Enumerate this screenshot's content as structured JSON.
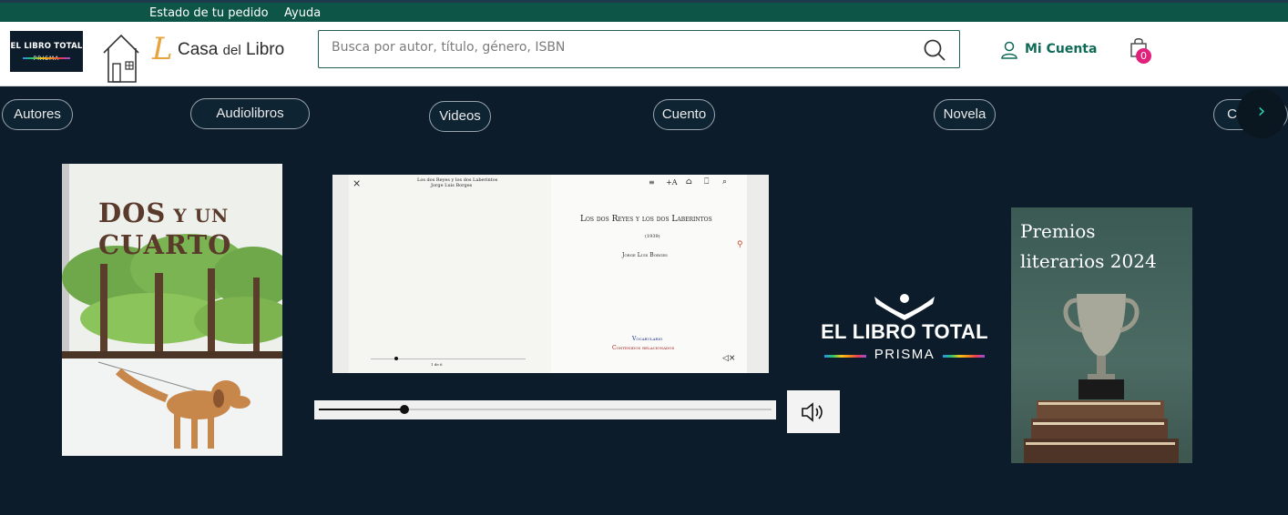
{
  "topbar": {
    "order_status": "Estado de tu pedido",
    "help": "Ayuda"
  },
  "header": {
    "badge_line1": "EL LIBRO TOTAL",
    "badge_line2": "PRISMA",
    "logo_mark": "L",
    "logo_text_1": "Casa ",
    "logo_text_2": "del",
    "logo_text_3": " Libro",
    "search_placeholder": "Busca por autor, título, género, ISBN",
    "account_label": "Mi Cuenta",
    "cart_count": "0"
  },
  "categories": [
    "Autores",
    "Audiolibros",
    "Videos",
    "Cuento",
    "Novela",
    "Crónica"
  ],
  "cover1": {
    "title_line1": "DOS",
    "title_small": " Y UN",
    "title_line2": "CUARTO"
  },
  "viewer": {
    "header_text_1": "Los dos Reyes y los dos Laberintos",
    "header_text_2": "Jorge Luis Borges",
    "book_title": "Los dos Reyes y los dos Laberintos",
    "year": "(1939)",
    "author": "Jorge Luis Borges",
    "vocab_link": "Vocabulario",
    "related_link": "Contenidos relacionados",
    "page_number": "1 de 6",
    "audio_progress": 0.19
  },
  "prisma_logo": {
    "line1": "EL LIBRO TOTAL",
    "line2": "PRISMA"
  },
  "premios": {
    "line1": "Premios",
    "line2": "literarios 2024"
  },
  "colors": {
    "topbar": "#0c5547",
    "background": "#0d1c2a",
    "accent": "#0f6b57",
    "cart_badge": "#e0207a"
  }
}
